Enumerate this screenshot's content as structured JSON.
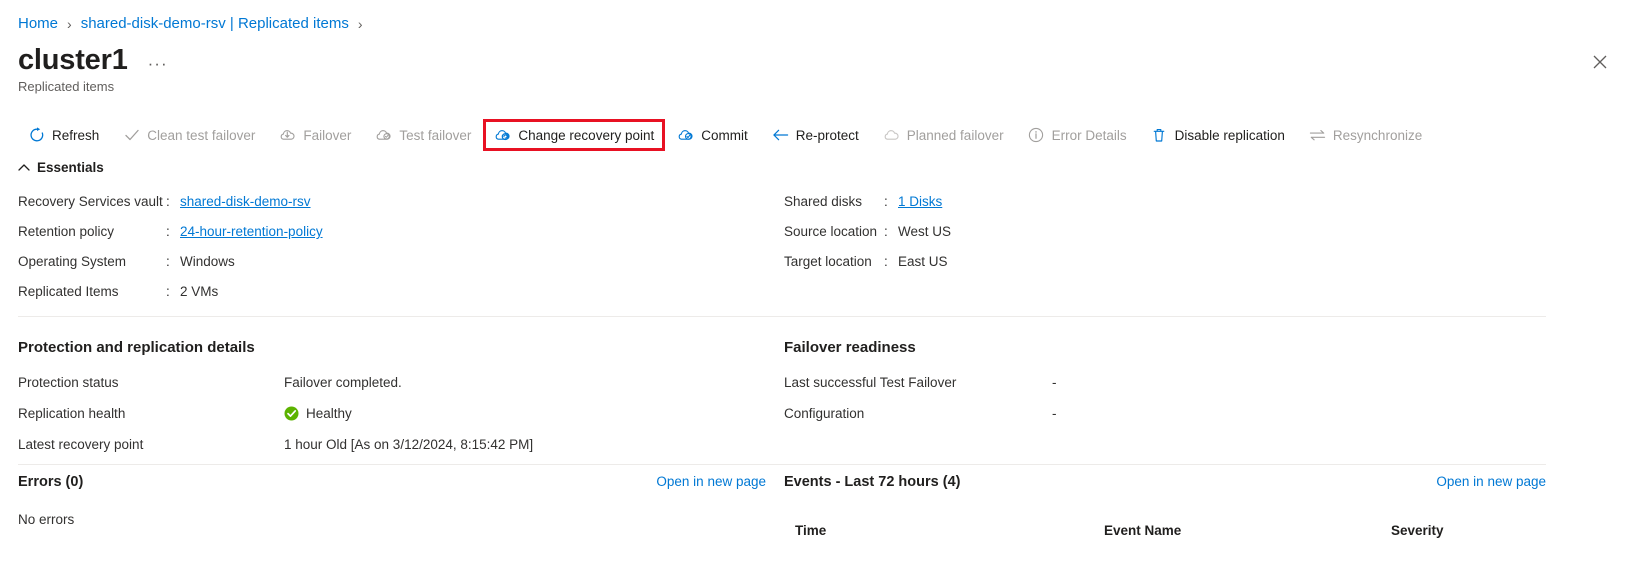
{
  "breadcrumb": {
    "items": [
      {
        "label": "Home",
        "type": "link"
      },
      {
        "label": "shared-disk-demo-rsv | Replicated items",
        "type": "link"
      }
    ],
    "separator": "›"
  },
  "header": {
    "title": "cluster1",
    "ellipsis": "···",
    "subtitle": "Replicated items",
    "close_icon": "close-icon"
  },
  "toolbar": {
    "commands": [
      {
        "label": "Refresh",
        "icon": "refresh-icon",
        "disabled": false,
        "highlighted": false
      },
      {
        "label": "Clean test failover",
        "icon": "checkmark-icon",
        "disabled": true,
        "highlighted": false
      },
      {
        "label": "Failover",
        "icon": "failover-cloud-icon",
        "disabled": true,
        "highlighted": false
      },
      {
        "label": "Test failover",
        "icon": "test-failover-icon",
        "disabled": true,
        "highlighted": false
      },
      {
        "label": "Change recovery point",
        "icon": "change-recovery-point-icon",
        "disabled": false,
        "highlighted": true
      },
      {
        "label": "Commit",
        "icon": "commit-icon",
        "disabled": false,
        "highlighted": false
      },
      {
        "label": "Re-protect",
        "icon": "arrow-left-icon",
        "disabled": false,
        "highlighted": false
      },
      {
        "label": "Planned failover",
        "icon": "planned-failover-icon",
        "disabled": true,
        "highlighted": false
      },
      {
        "label": "Error Details",
        "icon": "info-circle-icon",
        "disabled": true,
        "highlighted": false
      },
      {
        "label": "Disable replication",
        "icon": "trash-icon",
        "disabled": false,
        "highlighted": false
      },
      {
        "label": "Resynchronize",
        "icon": "resync-arrows-icon",
        "disabled": true,
        "highlighted": false
      }
    ],
    "highlight_color": "#e81123"
  },
  "essentials": {
    "title": "Essentials",
    "chevron_icon": "chevron-up-icon",
    "left": [
      {
        "label": "Recovery Services vault",
        "colon": ":",
        "value": "shared-disk-demo-rsv",
        "is_link": true
      },
      {
        "label": "Retention policy",
        "colon": ":",
        "value": "24-hour-retention-policy",
        "is_link": true
      },
      {
        "label": "Operating System",
        "colon": ":",
        "value": "Windows",
        "is_link": false
      },
      {
        "label": "Replicated Items",
        "colon": ":",
        "value": "2 VMs",
        "is_link": false
      }
    ],
    "right": [
      {
        "label": "Shared disks",
        "colon": ":",
        "value": "1 Disks",
        "is_link": true
      },
      {
        "label": "Source location",
        "colon": ":",
        "value": "West US",
        "is_link": false
      },
      {
        "label": "Target location",
        "colon": ":",
        "value": "East US",
        "is_link": false
      }
    ]
  },
  "protection_details": {
    "title": "Protection and replication details",
    "rows": [
      {
        "key": "Protection status",
        "value": "Failover completed.",
        "badge": ""
      },
      {
        "key": "Replication health",
        "value": "Healthy",
        "badge": "healthy-check-icon"
      },
      {
        "key": "Latest recovery point",
        "value": "1 hour Old [As on 3/12/2024, 8:15:42 PM]",
        "badge": ""
      }
    ],
    "healthy_color": "#5cb300"
  },
  "failover_readiness": {
    "title": "Failover readiness",
    "rows": [
      {
        "key": "Last successful Test Failover",
        "value": "-"
      },
      {
        "key": "Configuration",
        "value": "-"
      }
    ]
  },
  "errors_panel": {
    "title": "Errors (0)",
    "link": "Open in new page",
    "body": "No errors"
  },
  "events_panel": {
    "title": "Events - Last 72 hours (4)",
    "link": "Open in new page",
    "columns": {
      "time": "Time",
      "event_name": "Event Name",
      "severity": "Severity"
    },
    "rows": []
  },
  "colors": {
    "link": "#0078d4",
    "text": "#323130",
    "muted": "#605e5c",
    "disabled": "#a19f9d",
    "divider": "#edebe9"
  }
}
